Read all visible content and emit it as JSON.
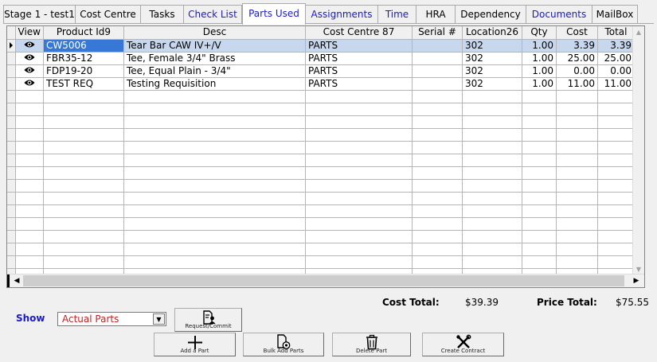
{
  "tabs": [
    {
      "label": "Stage 1 - test1",
      "blue": false,
      "active": false
    },
    {
      "label": "Cost Centre",
      "blue": false,
      "active": false
    },
    {
      "label": "Tasks",
      "blue": false,
      "active": false
    },
    {
      "label": "Check List",
      "blue": true,
      "active": false
    },
    {
      "label": "Parts Used",
      "blue": true,
      "active": true
    },
    {
      "label": "Assignments",
      "blue": true,
      "active": false
    },
    {
      "label": "Time",
      "blue": true,
      "active": false
    },
    {
      "label": "HRA",
      "blue": false,
      "active": false
    },
    {
      "label": "Dependency",
      "blue": false,
      "active": false
    },
    {
      "label": "Documents",
      "blue": true,
      "active": false
    },
    {
      "label": "MailBox",
      "blue": false,
      "active": false
    }
  ],
  "grid": {
    "columns": [
      "View",
      "Product Id9",
      "Desc",
      "Cost Centre 87",
      "Serial #",
      "Location26",
      "Qty",
      "Cost",
      "Total"
    ],
    "rows": [
      {
        "product": "CW5006",
        "desc": "Tear Bar CAW IV+/V",
        "cost_centre": "PARTS",
        "serial": "",
        "location": "302",
        "qty": "1.00",
        "cost": "3.39",
        "total": "3.39",
        "selected": true
      },
      {
        "product": "FBR35-12",
        "desc": "Tee, Female 3/4\" Brass",
        "cost_centre": "PARTS",
        "serial": "",
        "location": "302",
        "qty": "1.00",
        "cost": "25.00",
        "total": "25.00",
        "selected": false
      },
      {
        "product": "FDP19-20",
        "desc": "Tee, Equal Plain - 3/4\"",
        "cost_centre": "PARTS",
        "serial": "",
        "location": "302",
        "qty": "1.00",
        "cost": "0.00",
        "total": "0.00",
        "selected": false
      },
      {
        "product": "TEST REQ",
        "desc": "Testing Requisition",
        "cost_centre": "PARTS",
        "serial": "",
        "location": "302",
        "qty": "1.00",
        "cost": "11.00",
        "total": "11.00",
        "selected": false
      }
    ]
  },
  "totals": {
    "cost_label": "Cost Total:",
    "cost_value": "$39.39",
    "price_label": "Price Total:",
    "price_value": "$75.55"
  },
  "show": {
    "label": "Show",
    "selected": "Actual Parts"
  },
  "buttons": {
    "request_commit": "Request/Commit",
    "add_part": "Add a Part",
    "bulk_add_parts": "Bulk Add Parts",
    "delete_part": "Delete Part",
    "create_contract": "Create Contract"
  },
  "icons": {
    "row_view": "eye-icon",
    "current_row": "row-pointer-icon",
    "request_commit": "person-document-icon",
    "add_part": "plus-icon",
    "bulk_add_parts": "document-gear-icon",
    "delete_part": "trash-icon",
    "create_contract": "tools-icon"
  },
  "colors": {
    "link_blue": "#1a1acd",
    "selected_row": "#c6d7ee",
    "selected_cell": "#3777d6",
    "dropdown_text": "#c81e1e"
  }
}
